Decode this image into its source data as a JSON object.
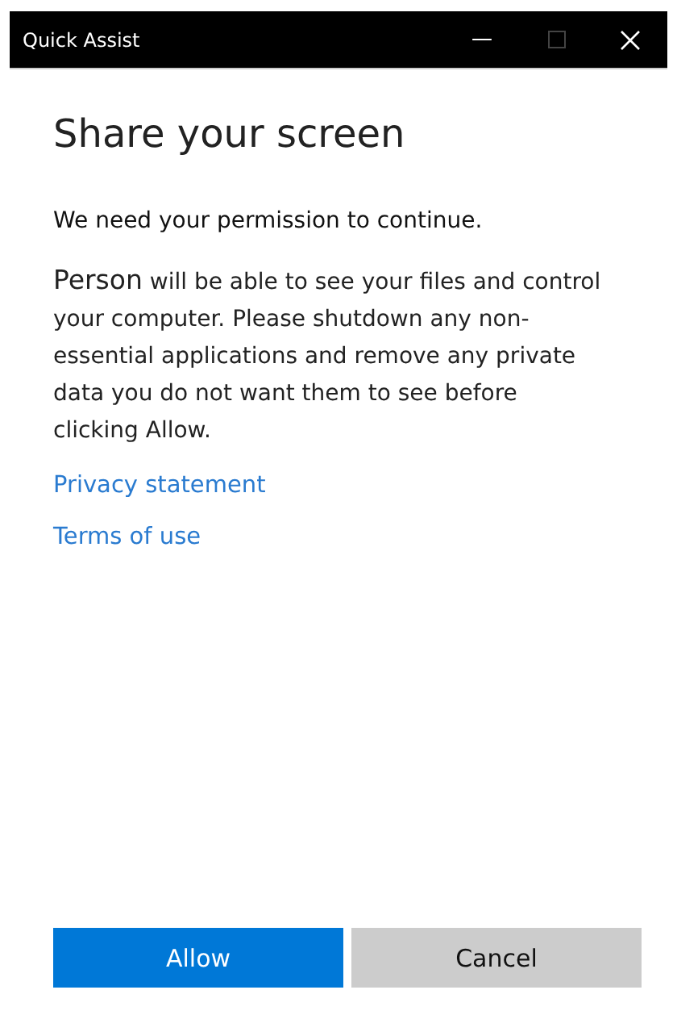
{
  "window": {
    "title": "Quick Assist",
    "maximize_disabled": true
  },
  "heading": "Share your screen",
  "intro": "We need your permission to continue.",
  "message": {
    "name": "Person",
    "text": "will be able to see your files and control your computer. Please shutdown any non-essential applications and remove any private data you do not want them to see before clicking Allow."
  },
  "links": [
    "Privacy statement",
    "Terms of use"
  ],
  "buttons": [
    {
      "label": "Allow",
      "kind": "primary"
    },
    {
      "label": "Cancel",
      "kind": "secondary"
    }
  ]
}
